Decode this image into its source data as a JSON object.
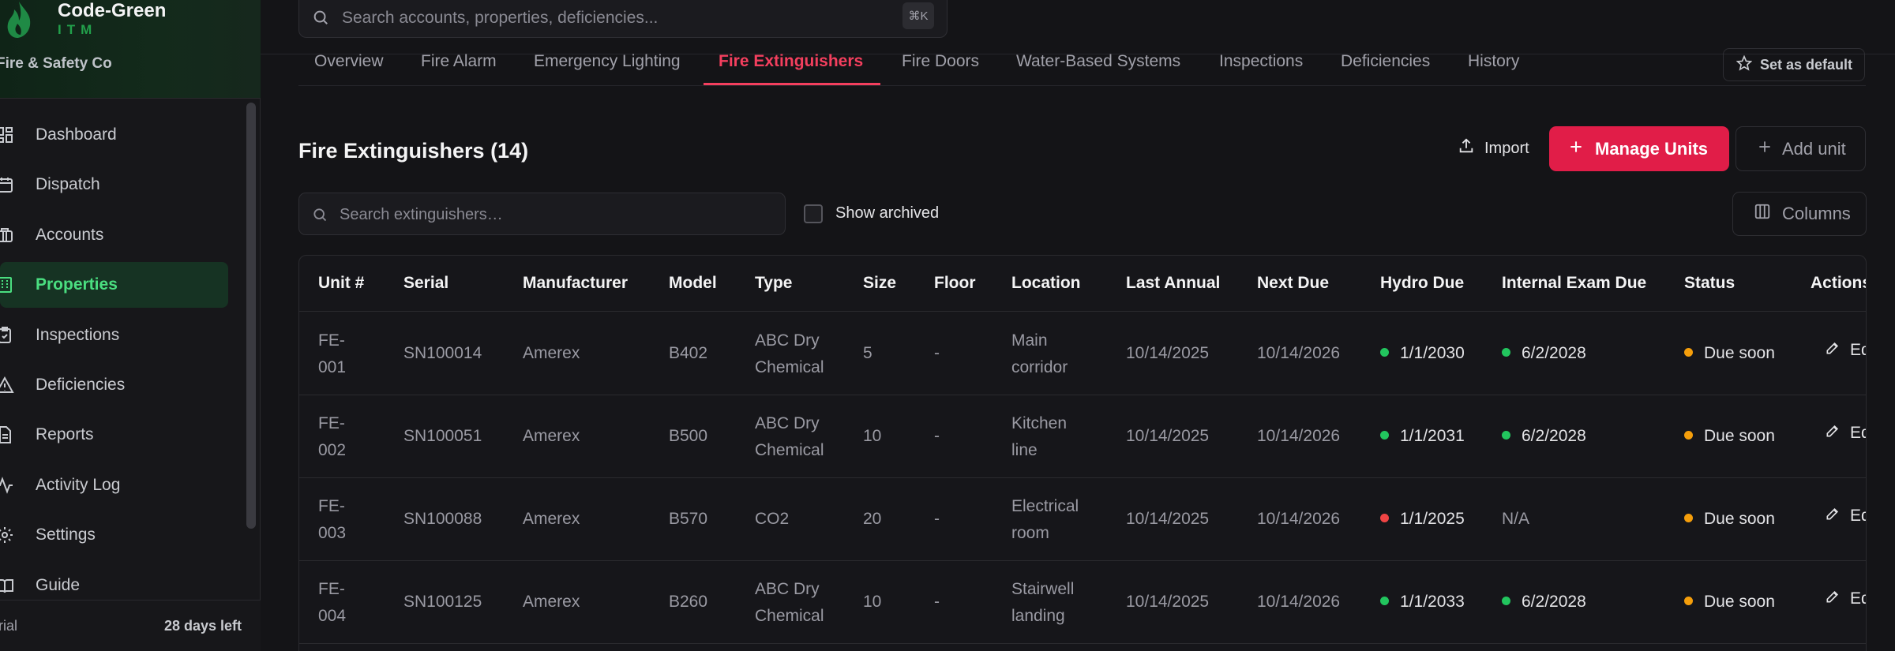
{
  "brand": {
    "name": "Code-Green",
    "sub": "ITM",
    "company": "Fire & Safety Co"
  },
  "nav": [
    {
      "label": "Dashboard",
      "icon": "dashboard-icon"
    },
    {
      "label": "Dispatch",
      "icon": "calendar-icon"
    },
    {
      "label": "Accounts",
      "icon": "briefcase-icon"
    },
    {
      "label": "Properties",
      "icon": "building-icon",
      "active": true
    },
    {
      "label": "Inspections",
      "icon": "clipboard-check-icon"
    },
    {
      "label": "Deficiencies",
      "icon": "warning-triangle-icon"
    },
    {
      "label": "Reports",
      "icon": "document-icon"
    },
    {
      "label": "Activity Log",
      "icon": "activity-icon"
    },
    {
      "label": "Settings",
      "icon": "gear-icon"
    },
    {
      "label": "Guide",
      "icon": "book-icon"
    }
  ],
  "trial": {
    "left": "rial",
    "right": "28 days left"
  },
  "search": {
    "placeholder": "Search accounts, properties, deficiencies...",
    "shortcut": "⌘K"
  },
  "tabs": [
    {
      "label": "Overview"
    },
    {
      "label": "Fire Alarm"
    },
    {
      "label": "Emergency Lighting"
    },
    {
      "label": "Fire Extinguishers",
      "active": true
    },
    {
      "label": "Fire Doors"
    },
    {
      "label": "Water-Based Systems"
    },
    {
      "label": "Inspections"
    },
    {
      "label": "Deficiencies"
    },
    {
      "label": "History"
    }
  ],
  "set_default": "Set as default",
  "section": {
    "title": "Fire Extinguishers (14)",
    "import": "Import",
    "manage": "Manage Units",
    "add": "Add unit",
    "search_placeholder": "Search extinguishers…",
    "show_archived": "Show archived",
    "columns": "Columns"
  },
  "table": {
    "headers": [
      "Unit #",
      "Serial",
      "Manufacturer",
      "Model",
      "Type",
      "Size",
      "Floor",
      "Location",
      "Last Annual",
      "Next Due",
      "Hydro Due",
      "Internal Exam Due",
      "Status",
      "Actions"
    ],
    "rows": [
      {
        "unit": [
          "FE-",
          "001"
        ],
        "serial": "SN100014",
        "manufacturer": "Amerex",
        "model": "B402",
        "type": [
          "ABC Dry",
          "Chemical"
        ],
        "size": "5",
        "floor": "-",
        "location": [
          "Main",
          "corridor"
        ],
        "last_annual": "10/14/2025",
        "next_due": "10/14/2026",
        "hydro": "1/1/2030",
        "hydro_color": "#22c55e",
        "internal": "6/2/2028",
        "internal_color": "#22c55e",
        "status": "Due soon",
        "status_color": "#f59e0b",
        "action": "Ed"
      },
      {
        "unit": [
          "FE-",
          "002"
        ],
        "serial": "SN100051",
        "manufacturer": "Amerex",
        "model": "B500",
        "type": [
          "ABC Dry",
          "Chemical"
        ],
        "size": "10",
        "floor": "-",
        "location": [
          "Kitchen",
          "line"
        ],
        "last_annual": "10/14/2025",
        "next_due": "10/14/2026",
        "hydro": "1/1/2031",
        "hydro_color": "#22c55e",
        "internal": "6/2/2028",
        "internal_color": "#22c55e",
        "status": "Due soon",
        "status_color": "#f59e0b",
        "action": "Ed"
      },
      {
        "unit": [
          "FE-",
          "003"
        ],
        "serial": "SN100088",
        "manufacturer": "Amerex",
        "model": "B570",
        "type": [
          "CO2"
        ],
        "size": "20",
        "floor": "-",
        "location": [
          "Electrical",
          "room"
        ],
        "last_annual": "10/14/2025",
        "next_due": "10/14/2026",
        "hydro": "1/1/2025",
        "hydro_color": "#ef4444",
        "internal": "N/A",
        "internal_color": "",
        "status": "Due soon",
        "status_color": "#f59e0b",
        "action": "Ed"
      },
      {
        "unit": [
          "FE-",
          "004"
        ],
        "serial": "SN100125",
        "manufacturer": "Amerex",
        "model": "B260",
        "type": [
          "ABC Dry",
          "Chemical"
        ],
        "size": "10",
        "floor": "-",
        "location": [
          "Stairwell",
          "landing"
        ],
        "last_annual": "10/14/2025",
        "next_due": "10/14/2026",
        "hydro": "1/1/2033",
        "hydro_color": "#22c55e",
        "internal": "6/2/2028",
        "internal_color": "#22c55e",
        "status": "Due soon",
        "status_color": "#f59e0b",
        "action": "Ed"
      }
    ]
  },
  "colors": {
    "accent": "#e11d48",
    "active_nav": "#4ade80",
    "active_nav_bg": "#163323"
  }
}
